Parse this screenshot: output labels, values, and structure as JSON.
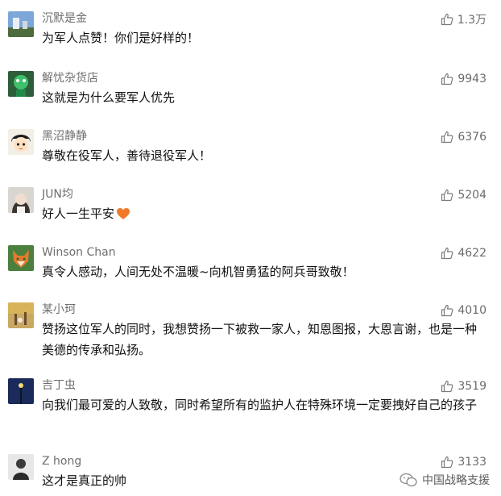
{
  "comments": [
    {
      "user": "沉默是金",
      "text": "为军人点赞！你们是好样的！",
      "likes": "1.3万",
      "avatar": "landscape-avatar"
    },
    {
      "user": "解忧杂货店",
      "text": "这就是为什么要军人优先",
      "likes": "9943",
      "avatar": "cartoon-avatar"
    },
    {
      "user": "黑沼静静",
      "text": "尊敬在役军人，善待退役军人！",
      "likes": "6376",
      "avatar": "anime-avatar"
    },
    {
      "user": "JUN均",
      "text": "好人一生平安",
      "likes": "5204",
      "avatar": "portrait-avatar"
    },
    {
      "user": "Winson Chan",
      "text": "真令人感动，人间无处不温暖~向机智勇猛的阿兵哥致敬！",
      "likes": "4622",
      "avatar": "fox-avatar"
    },
    {
      "user": "某小珂",
      "text": "赞扬这位军人的同时，我想赞扬一下被救一家人，知恩图报，大恩言谢，也是一种美德的传承和弘扬。",
      "likes": "4010",
      "avatar": "autumn-avatar"
    },
    {
      "user": "吉丁虫",
      "text": "向我们最可爱的人致敬，同时希望所有的监护人在特殊环境一定要拽好自己的孩子",
      "likes": "3519",
      "avatar": "streetlamp-avatar"
    },
    {
      "user": "Z hong",
      "text": "这才是真正的帅",
      "likes": "3133",
      "avatar": "man-avatar"
    }
  ],
  "watermark": "中国战略支援",
  "colors": {
    "name": "#6f6f6f",
    "text": "#111111",
    "like": "#6b6b6b",
    "heart": "#f07a2c"
  }
}
